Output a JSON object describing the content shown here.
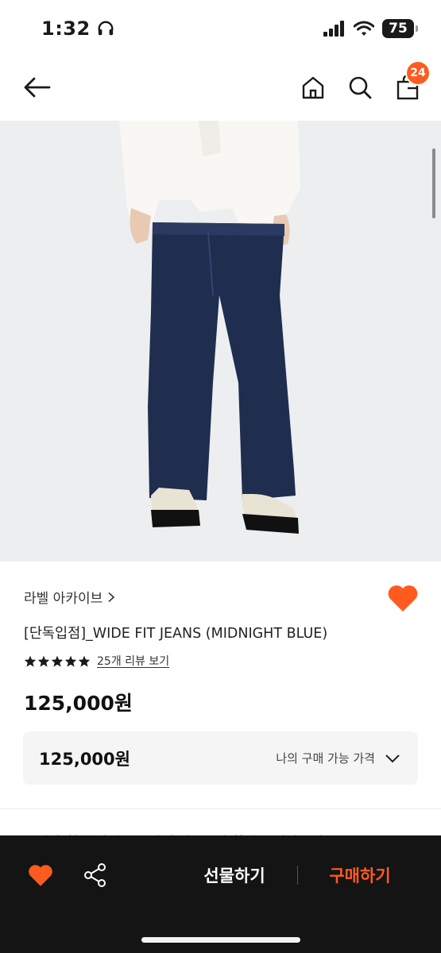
{
  "status_bar": {
    "time": "1:32",
    "battery": "75"
  },
  "nav": {
    "back_icon": "arrow-left-icon",
    "home_icon": "home-icon",
    "search_icon": "search-icon",
    "bag_icon": "shopping-bag-icon",
    "bag_count": "24"
  },
  "product": {
    "image_icon": "jeans-photo",
    "brand": "라벨 아카이브",
    "title": "[단독입점]_WIDE FIT JEANS (MIDNIGHT BLUE)",
    "rating_stars": 5,
    "review_link": "25개 리뷰 보기",
    "price": "125,000원",
    "my_price_value": "125,000원",
    "my_price_label": "나의 구매 가능 가격",
    "cut_text": "무신사 회원 혜택으로 최대 적립금과 할인을 받아보세요"
  },
  "bottom_bar": {
    "gift_label": "선물하기",
    "buy_label": "구매하기"
  },
  "colors": {
    "accent": "#ff5a1f",
    "bottom_bar_bg": "#141414",
    "price_box_bg": "#f5f5f6"
  }
}
